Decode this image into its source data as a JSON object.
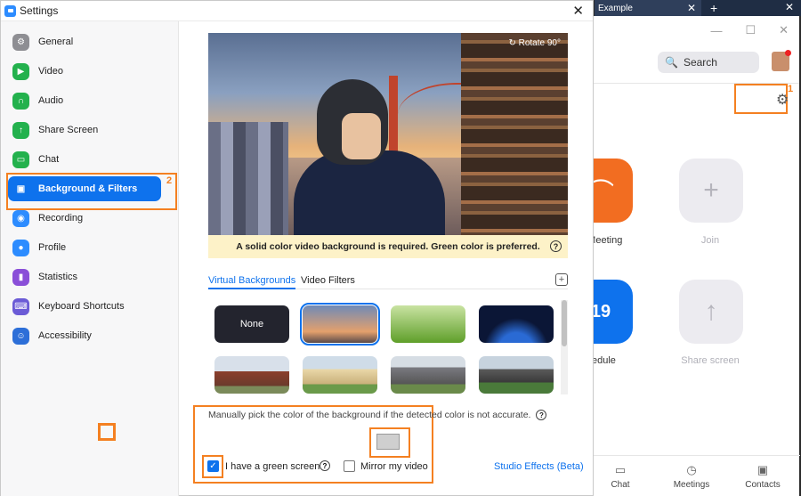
{
  "window": {
    "title": "Settings"
  },
  "sidebar": [
    "General",
    "Video",
    "Audio",
    "Share Screen",
    "Chat",
    "Background & Filters",
    "Recording",
    "Profile",
    "Statistics",
    "Keyboard Shortcuts",
    "Accessibility"
  ],
  "markers": {
    "m1": "1",
    "m2": "2"
  },
  "preview": {
    "rotate": "Rotate 90°",
    "notice": "A solid color video background is required. Green color is preferred."
  },
  "tabs": [
    "Virtual Backgrounds",
    "Video Filters"
  ],
  "backgrounds": {
    "none": "None"
  },
  "options": {
    "manual": "Manually pick the color of the background if the detected color is not accurate.",
    "green_screen": "I have a green screen",
    "mirror": "Mirror my video",
    "studio": "Studio Effects (Beta)"
  },
  "bg_app": {
    "tab_title": "Example",
    "search": "Search",
    "new_meeting": "o Meeting",
    "join": "Join",
    "schedule": "edule",
    "share_screen": "Share screen",
    "nav": [
      "Chat",
      "Meetings",
      "Contacts"
    ]
  },
  "colors": {
    "accent": "#0e72ed",
    "highlight": "#f48021",
    "notice_bg": "#fdf2c8"
  }
}
